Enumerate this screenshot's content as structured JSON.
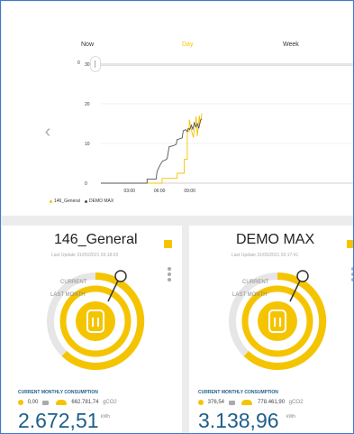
{
  "periods": {
    "now": "Now",
    "day": "Day",
    "week": "Week"
  },
  "slider_value": "0",
  "chart": {
    "y_ticks": [
      "30",
      "20",
      "10",
      "0"
    ],
    "x_ticks": [
      "03:00",
      "06:00",
      "09:00"
    ],
    "legend": [
      {
        "name": "146_General",
        "color": "#f5c400"
      },
      {
        "name": "DEMO MAX",
        "color": "#555555"
      }
    ]
  },
  "chart_data": {
    "type": "line",
    "xlabel": "",
    "ylabel": "",
    "ylim": [
      0,
      30
    ],
    "x_ticks": [
      "03:00",
      "06:00",
      "09:00"
    ],
    "series": [
      {
        "name": "146_General",
        "color": "#f5c400",
        "points": [
          [
            0,
            0.0
          ],
          [
            6.1,
            0.0
          ],
          [
            6.1,
            1.2
          ],
          [
            7.6,
            1.2
          ],
          [
            7.6,
            2.5
          ],
          [
            8.3,
            2.5
          ],
          [
            8.3,
            6.0
          ],
          [
            8.6,
            6.0
          ],
          [
            8.6,
            13.0
          ],
          [
            8.8,
            13.0
          ],
          [
            8.8,
            16.0
          ],
          [
            9.0,
            13.5
          ],
          [
            9.2,
            11.5
          ],
          [
            9.5,
            16.8
          ],
          [
            9.6,
            11.8
          ],
          [
            9.8,
            17.0
          ],
          [
            9.9,
            15.0
          ],
          [
            10.05,
            17.6
          ]
        ]
      },
      {
        "name": "DEMO MAX",
        "color": "#555555",
        "points": [
          [
            0,
            0.0
          ],
          [
            4.6,
            0.0
          ],
          [
            4.6,
            1.0
          ],
          [
            5.5,
            1.0
          ],
          [
            5.6,
            3.0
          ],
          [
            5.9,
            4.6
          ],
          [
            6.15,
            5.6
          ],
          [
            6.4,
            5.8
          ],
          [
            6.6,
            6.2
          ],
          [
            6.8,
            9.2
          ],
          [
            7.2,
            9.4
          ],
          [
            7.5,
            9.8
          ],
          [
            7.6,
            11.0
          ],
          [
            7.9,
            11.2
          ],
          [
            8.1,
            11.4
          ],
          [
            8.2,
            13.2
          ],
          [
            8.45,
            13.5
          ],
          [
            8.6,
            13.0
          ],
          [
            8.7,
            13.8
          ],
          [
            8.85,
            13.5
          ],
          [
            9.0,
            14.6
          ],
          [
            9.15,
            13.6
          ],
          [
            9.3,
            15.2
          ],
          [
            9.45,
            14.2
          ],
          [
            9.6,
            15.0
          ],
          [
            9.75,
            13.8
          ],
          [
            9.9,
            15.8
          ],
          [
            10.05,
            16.2
          ]
        ]
      }
    ]
  },
  "meters": [
    {
      "title": "146_General",
      "last_update": "Last Update 31/05/2021 03:18:03",
      "label_current": "CURRENT",
      "label_last_month": "LAST MONTH",
      "consumption_label": "CURRENT MONTHLY CONSUMPTION",
      "cost_value": "0,00",
      "co2_value": "662.781,74",
      "co2_unit": "gCO2",
      "energy_value": "2.672,51",
      "energy_unit": "kWh"
    },
    {
      "title": "DEMO MAX",
      "last_update": "Last Update 31/05/2021 03:17:41",
      "label_current": "CURRENT",
      "label_last_month": "LAST MONTH",
      "consumption_label": "CURRENT MONTHLY CONSUMPTION",
      "cost_value": "376,54",
      "co2_value": "778.461,90",
      "co2_unit": "gCO2",
      "energy_value": "3.138,96",
      "energy_unit": "kWh"
    }
  ],
  "colors": {
    "accent": "#f5c400",
    "primary_text": "#1d5f8a",
    "gauge_track": "#e6e6e6"
  }
}
